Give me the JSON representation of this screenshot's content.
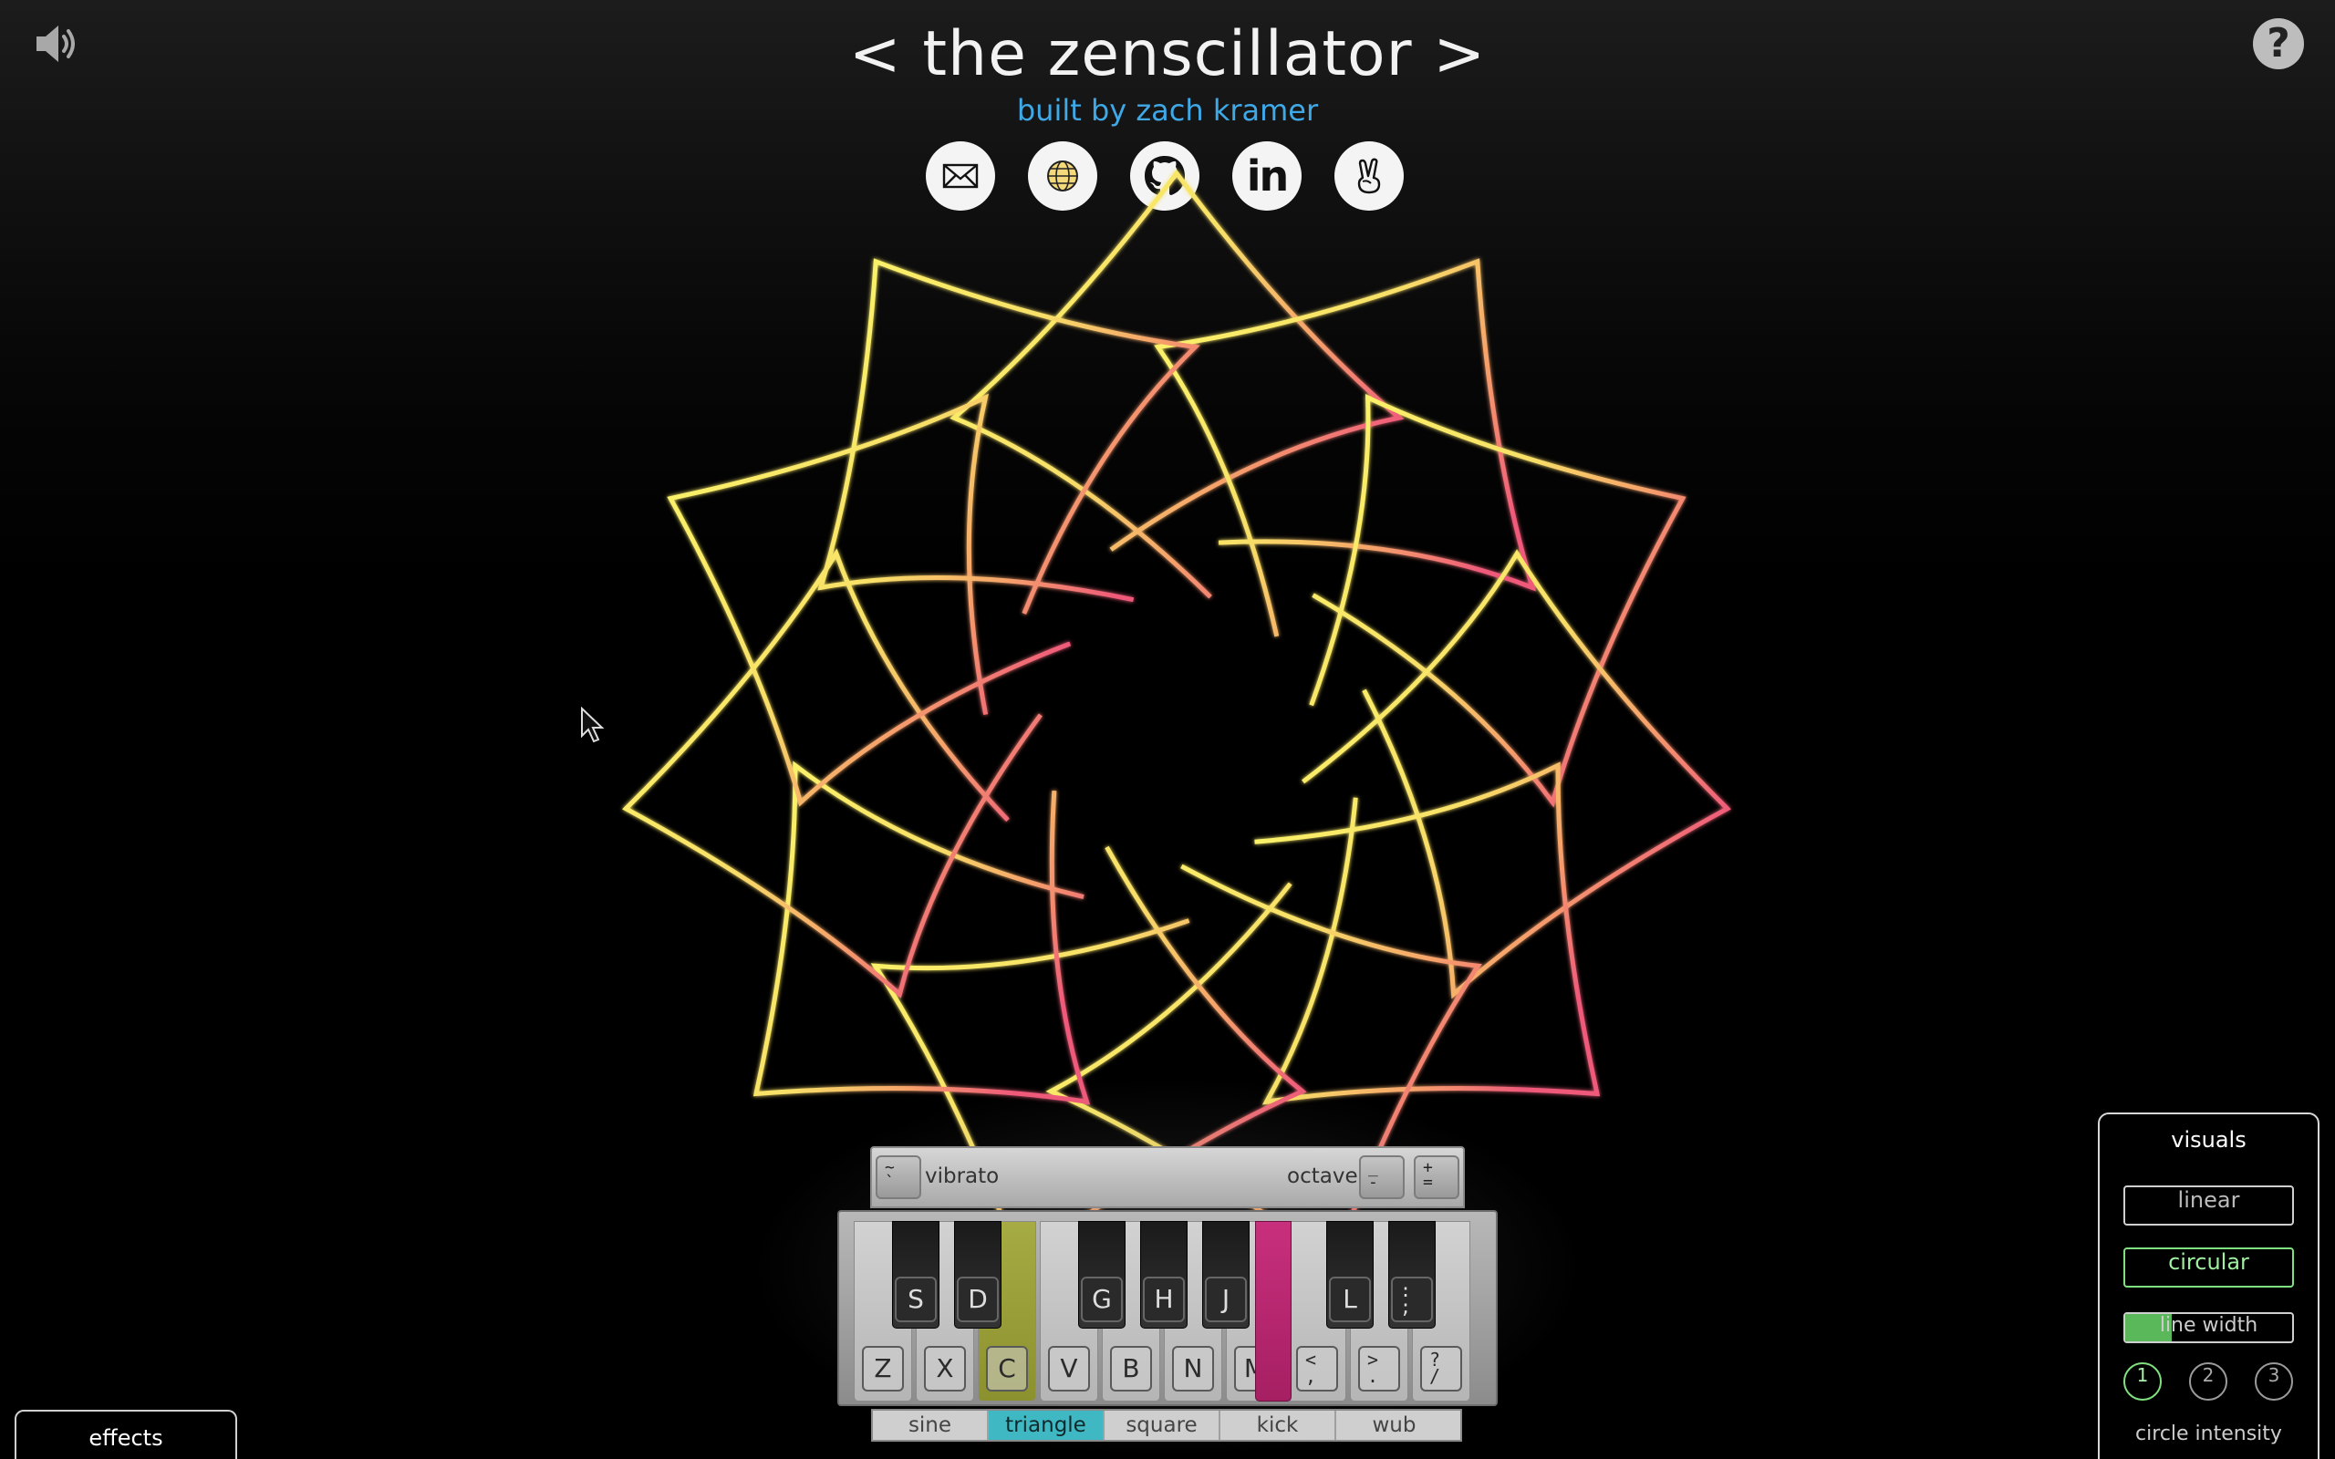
{
  "app": {
    "title": "< the zenscillator >",
    "subtitle": "built by zach kramer"
  },
  "icons": {
    "sound": "speaker-icon",
    "help": "?"
  },
  "socials": [
    {
      "name": "email",
      "icon": "envelope-icon"
    },
    {
      "name": "website",
      "icon": "globe-icon"
    },
    {
      "name": "github",
      "icon": "github-icon"
    },
    {
      "name": "linkedin",
      "icon": "linkedin-icon",
      "glyph": "in"
    },
    {
      "name": "angellist",
      "icon": "peace-hand-icon"
    }
  ],
  "controls": {
    "vibrato_key": "~\n`",
    "vibrato_label": "vibrato",
    "octave_label": "octave",
    "octave_down_key": "_\n-",
    "octave_up_key": "+\n="
  },
  "keyboard": {
    "black_keys": [
      "S",
      "D",
      "G",
      "H",
      "J",
      "L",
      ":\n;"
    ],
    "white_keys": [
      "Z",
      "X",
      "C",
      "V",
      "B",
      "N",
      "M",
      "<\n,",
      ">\n.",
      "?\n/"
    ],
    "active_white": "C",
    "active_black": "M",
    "active_colors": {
      "c": "#a6ab43",
      "m": "#c82f7d"
    }
  },
  "waveforms": {
    "options": [
      "sine",
      "triangle",
      "square",
      "kick",
      "wub"
    ],
    "selected": "triangle",
    "selected_color": "#3fb8c3"
  },
  "effects": {
    "label": "effects"
  },
  "visuals": {
    "title": "visuals",
    "modes": [
      "linear",
      "circular"
    ],
    "selected_mode": "circular",
    "line_width_label": "line width",
    "line_width_value": 0.28,
    "circle_options": [
      "1",
      "2",
      "3"
    ],
    "selected_circle": "1",
    "footer": "circle intensity",
    "accent": "#7fe07f"
  }
}
